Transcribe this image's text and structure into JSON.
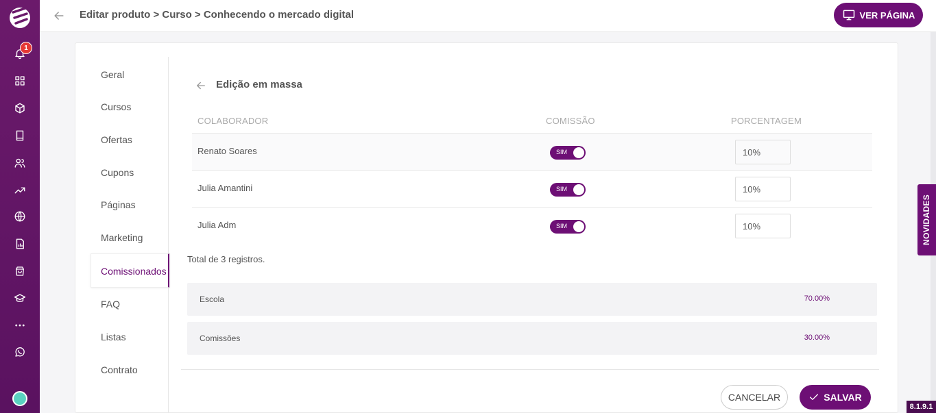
{
  "app": {
    "version": "8.1.9.1",
    "notifications_count": "1"
  },
  "header": {
    "breadcrumb": "Editar produto > Curso > Conhecendo o mercado digital",
    "view_page_label": "VER PÁGINA"
  },
  "sidebar_icons": [
    "bell-icon",
    "grid-icon",
    "box-icon",
    "book-icon",
    "users-icon",
    "trend-icon",
    "globe-icon",
    "report-icon",
    "bag-icon",
    "graduation-icon",
    "more-icon",
    "whatsapp-icon"
  ],
  "nav": {
    "items": [
      "Geral",
      "Cursos",
      "Ofertas",
      "Cupons",
      "Páginas",
      "Marketing",
      "Comissionados",
      "FAQ",
      "Listas",
      "Contrato"
    ],
    "active": "Comissionados"
  },
  "section": {
    "title": "Edição em massa"
  },
  "table": {
    "headers": [
      "COLABORADOR",
      "COMISSÃO",
      "PORCENTAGEM"
    ],
    "rows": [
      {
        "name": "Renato Soares",
        "toggle": "SIM",
        "percent": "10%"
      },
      {
        "name": "Julia Amantini",
        "toggle": "SIM",
        "percent": "10%"
      },
      {
        "name": "Julia Adm",
        "toggle": "SIM",
        "percent": "10%"
      }
    ],
    "total": "Total de 3 registros."
  },
  "summary": [
    {
      "label": "Escola",
      "value": "70.00%"
    },
    {
      "label": "Comissões",
      "value": "30.00%"
    }
  ],
  "actions": {
    "cancel": "CANCELAR",
    "save": "SALVAR"
  },
  "side_tab": "NOVIDADES",
  "colors": {
    "brand": "#6d0f75",
    "rail": "#5a1260",
    "alert": "#e53935"
  }
}
